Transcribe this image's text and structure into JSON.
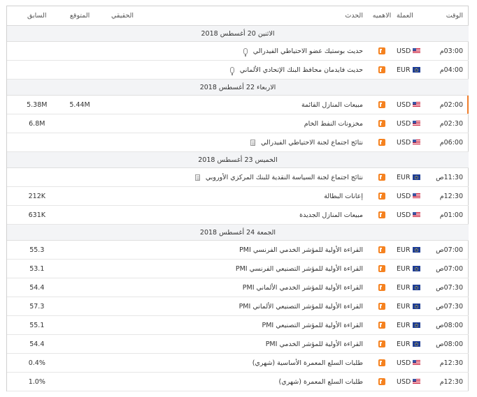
{
  "header": {
    "time": "الوقت",
    "currency": "العملة",
    "importance": "الاهميه",
    "event": "الحدث",
    "actual": "الحقيقي",
    "forecast": "المتوقع",
    "previous": "السابق"
  },
  "colors": {
    "accent": "#f58220",
    "highlight": "#f07d2a"
  },
  "days": [
    {
      "label": "الاثنين 20 أغسطس 2018",
      "rows": [
        {
          "time": "03:00م",
          "currency": "USD",
          "flag": "us-flag-icon",
          "event": "حديث بوستيك عضو الاحتياطي الفيدرالي",
          "icon": "microphone-icon",
          "actual": "",
          "forecast": "",
          "previous": ""
        },
        {
          "time": "04:00م",
          "currency": "EUR",
          "flag": "eu-flag-icon",
          "event": "حديث فايدمان محافظ البنك الإتحادي الألماني",
          "icon": "microphone-icon",
          "actual": "",
          "forecast": "",
          "previous": ""
        }
      ]
    },
    {
      "label": "الاربعاء 22 أغسطس 2018",
      "rows": [
        {
          "time": "02:00م",
          "currency": "USD",
          "flag": "us-flag-icon",
          "event": "مبيعات المنازل القائمة",
          "icon": "",
          "actual": "",
          "forecast": "5.44M",
          "previous": "5.38M",
          "highlight": true
        },
        {
          "time": "02:30م",
          "currency": "USD",
          "flag": "us-flag-icon",
          "event": "مخزونات النفط الخام",
          "icon": "",
          "actual": "",
          "forecast": "",
          "previous": "6.8M"
        },
        {
          "time": "06:00م",
          "currency": "USD",
          "flag": "us-flag-icon",
          "event": "نتائج اجتماع لجنة الاحتياطي الفيدرالي",
          "icon": "document-icon",
          "actual": "",
          "forecast": "",
          "previous": ""
        }
      ]
    },
    {
      "label": "الخميس 23 أغسطس 2018",
      "rows": [
        {
          "time": "11:30ص",
          "currency": "EUR",
          "flag": "eu-flag-icon",
          "event": "نتائج اجتماع لجنة السياسة النقدية للبنك المركزي الأوروبي",
          "icon": "document-icon",
          "actual": "",
          "forecast": "",
          "previous": ""
        },
        {
          "time": "12:30م",
          "currency": "USD",
          "flag": "us-flag-icon",
          "event": "إعانات البطالة",
          "icon": "",
          "actual": "",
          "forecast": "",
          "previous": "212K"
        },
        {
          "time": "01:00م",
          "currency": "USD",
          "flag": "us-flag-icon",
          "event": "مبيعات المنازل الجديدة",
          "icon": "",
          "actual": "",
          "forecast": "",
          "previous": "631K"
        }
      ]
    },
    {
      "label": "الجمعة 24 أغسطس 2018",
      "rows": [
        {
          "time": "07:00ص",
          "currency": "EUR",
          "flag": "eu-flag-icon",
          "event": "القراءة الأولية للمؤشر الخدمي الفرنسي PMI",
          "icon": "",
          "actual": "",
          "forecast": "",
          "previous": "55.3"
        },
        {
          "time": "07:00ص",
          "currency": "EUR",
          "flag": "eu-flag-icon",
          "event": "القراءة الأولية للمؤشر التصنيعي الفرنسي PMI",
          "icon": "",
          "actual": "",
          "forecast": "",
          "previous": "53.1"
        },
        {
          "time": "07:30ص",
          "currency": "EUR",
          "flag": "eu-flag-icon",
          "event": "القراءة الأولية للمؤشر الخدمي الألماني PMI",
          "icon": "",
          "actual": "",
          "forecast": "",
          "previous": "54.4"
        },
        {
          "time": "07:30ص",
          "currency": "EUR",
          "flag": "eu-flag-icon",
          "event": "القراءة الأولية للمؤشر التصنيعي الألماني PMI",
          "icon": "",
          "actual": "",
          "forecast": "",
          "previous": "57.3"
        },
        {
          "time": "08:00ص",
          "currency": "EUR",
          "flag": "eu-flag-icon",
          "event": "القراءة الأولية للمؤشر التصنيعي PMI",
          "icon": "",
          "actual": "",
          "forecast": "",
          "previous": "55.1"
        },
        {
          "time": "08:00ص",
          "currency": "EUR",
          "flag": "eu-flag-icon",
          "event": "القراءة الأولية للمؤشر الخدمي PMI",
          "icon": "",
          "actual": "",
          "forecast": "",
          "previous": "54.4"
        },
        {
          "time": "12:30م",
          "currency": "USD",
          "flag": "us-flag-icon",
          "event": "طلبات السلع المعمرة الأساسية (شهري)",
          "icon": "",
          "actual": "",
          "forecast": "",
          "previous": "0.4%"
        },
        {
          "time": "12:30م",
          "currency": "USD",
          "flag": "us-flag-icon",
          "event": "طلبات السلع المعمرة (شهري)",
          "icon": "",
          "actual": "",
          "forecast": "",
          "previous": "1.0%"
        }
      ]
    }
  ]
}
